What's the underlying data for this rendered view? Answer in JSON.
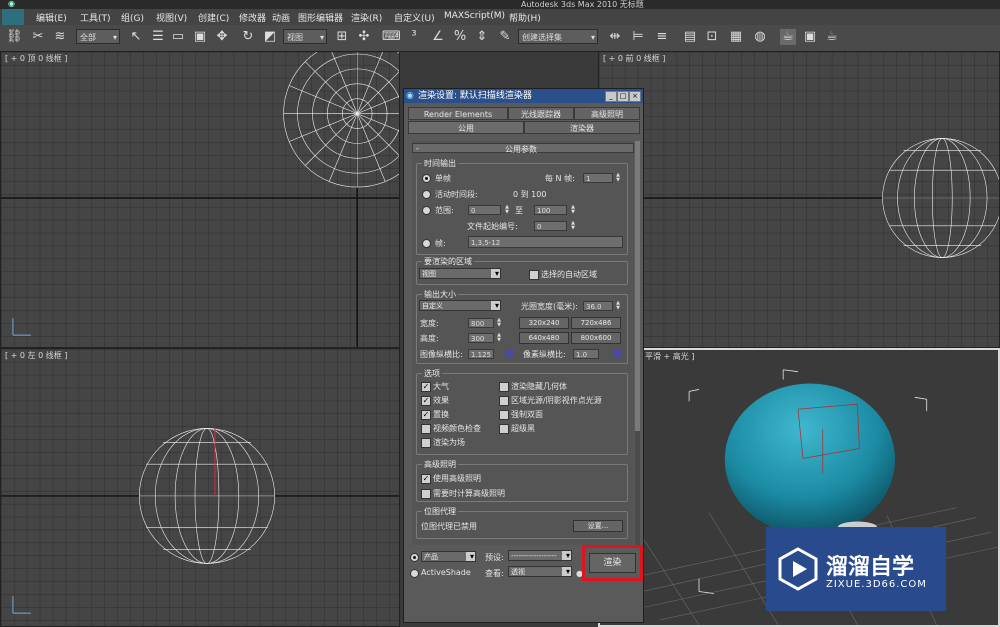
{
  "app": {
    "title": "Autodesk 3ds Max  2010    无标题"
  },
  "menu": [
    "编辑(E)",
    "工具(T)",
    "组(G)",
    "视图(V)",
    "创建(C)",
    "修改器",
    "动画",
    "图形编辑器",
    "渲染(R)",
    "自定义(U)",
    "MAXScript(M)",
    "帮助(H)"
  ],
  "toolbar": {
    "filter_select": "全部",
    "refcoord_select": "视图",
    "named_selection": "创建选择集"
  },
  "viewports": {
    "top": "[ + 0 顶 0 线框 ]",
    "front": "[ + 0 前 0 线框 ]",
    "left": "[ + 0 左 0 线框 ]",
    "perspective": "平滑 + 高光 ]"
  },
  "dialog": {
    "title": "渲染设置: 默认扫描线渲染器",
    "tabs_row1": [
      "Render Elements",
      "光线跟踪器",
      "高级照明"
    ],
    "tabs_row2": [
      "公用",
      "渲染器"
    ],
    "rollout_title": "公用参数",
    "time_output": {
      "label": "时间输出",
      "single": "单帧",
      "every_n": "每 N 帧:",
      "every_n_value": "1",
      "active_segment": "活动时间段:",
      "active_range": "0 到 100",
      "range": "范围:",
      "range_from": "0",
      "range_to_label": "至",
      "range_to": "100",
      "file_number_base": "文件起始编号:",
      "file_number_value": "0",
      "frames": "帧:",
      "frames_value": "1,3,5-12"
    },
    "area": {
      "label": "要渲染的区域",
      "select": "视图",
      "auto_region": "选择的自动区域"
    },
    "output_size": {
      "label": "输出大小",
      "select": "自定义",
      "aperture_label": "光圈宽度(毫米):",
      "aperture_value": "36.0",
      "width_label": "宽度:",
      "width_value": "800",
      "height_label": "高度:",
      "height_value": "300",
      "presets": [
        "320x240",
        "720x486",
        "640x480",
        "800x600"
      ],
      "image_aspect_label": "图像纵横比:",
      "image_aspect_value": "1.125",
      "pixel_aspect_label": "像素纵横比:",
      "pixel_aspect_value": "1.0"
    },
    "options": {
      "label": "选项",
      "atmospherics": "大气",
      "effects": "效果",
      "displacement": "置换",
      "video_color_check": "视频颜色检查",
      "render_to_fields": "渲染为场",
      "render_hidden": "渲染隐藏几何体",
      "area_lights": "区域光源/阴影视作点光源",
      "force_two_sided": "强制双面",
      "super_black": "超级黑"
    },
    "advanced_lighting": {
      "label": "高级照明",
      "use": "使用高级照明",
      "compute": "需要时计算高级照明"
    },
    "bitmap_proxy": {
      "label": "位图代理",
      "status": "位图代理已禁用",
      "setup": "设置..."
    },
    "bottom": {
      "production": "产品",
      "activeshade": "ActiveShade",
      "preset_label": "预设:",
      "preset_value": "------------------",
      "view_label": "查看:",
      "view_value": "透视",
      "render_button": "渲染"
    }
  },
  "watermark": {
    "title": "溜溜自学",
    "url": "ZIXUE.3D66.COM"
  },
  "colors": {
    "highlight": "#e0141e",
    "dialog_title": "#2a4f8a",
    "sphere": "#1f8fa6",
    "watermark_bg": "#2a4a8e"
  }
}
